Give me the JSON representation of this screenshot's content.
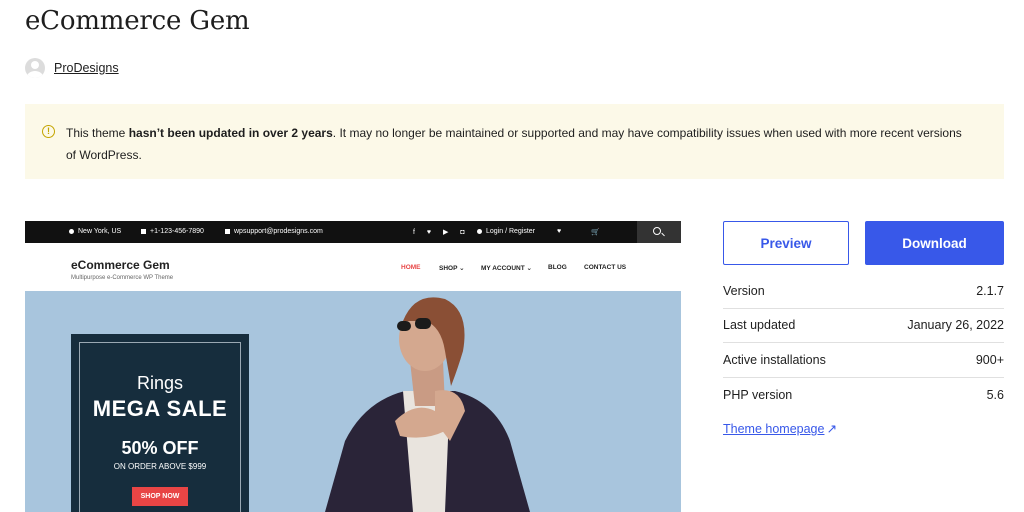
{
  "theme": {
    "title": "eCommerce Gem",
    "author": "ProDesigns"
  },
  "notice": {
    "before": "This theme ",
    "strong": "hasn’t been updated in over 2 years",
    "after": ". It may no longer be maintained or supported and may have compatibility issues when used with more recent versions of WordPress.",
    "icon": "warning-circle-icon"
  },
  "preview_shot": {
    "topbar": {
      "location": "New York, US",
      "phone": "+1-123-456-7890",
      "email": "wpsupport@prodesigns.com",
      "account": "Login / Register"
    },
    "site_title": "eCommerce Gem",
    "tagline": "Multipurpose e-Commerce WP Theme",
    "nav": {
      "home": "HOME",
      "shop": "SHOP ⌄",
      "account": "MY ACCOUNT ⌄",
      "blog": "BLOG",
      "contact": "CONTACT US"
    },
    "promo": {
      "rings": "Rings",
      "sale": "MEGA SALE",
      "off": "50% OFF",
      "order": "ON ORDER ABOVE $999",
      "button": "SHOP NOW"
    }
  },
  "actions": {
    "preview": "Preview",
    "download": "Download",
    "accent": "#3858e9"
  },
  "meta": [
    {
      "label": "Version",
      "value": "2.1.7"
    },
    {
      "label": "Last updated",
      "value": "January 26, 2022"
    },
    {
      "label": "Active installations",
      "value": "900+"
    },
    {
      "label": "PHP version",
      "value": "5.6"
    }
  ],
  "homepage_link": "Theme homepage"
}
